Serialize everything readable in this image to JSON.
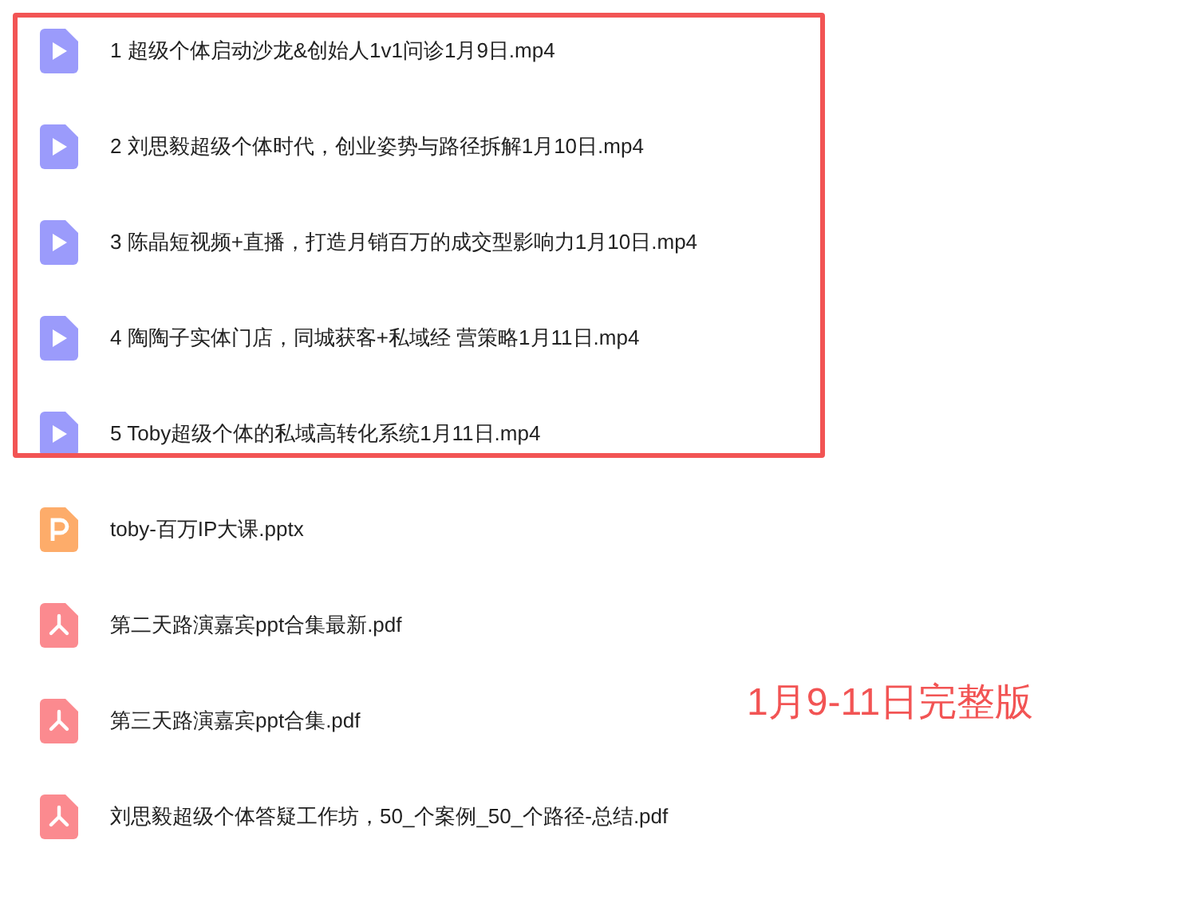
{
  "files": [
    {
      "kind": "video",
      "name": "1 超级个体启动沙龙&创始人1v1问诊1月9日.mp4"
    },
    {
      "kind": "video",
      "name": "2 刘思毅超级个体时代，创业姿势与路径拆解1月10日.mp4"
    },
    {
      "kind": "video",
      "name": "3 陈晶短视频+直播，打造月销百万的成交型影响力1月10日.mp4"
    },
    {
      "kind": "video",
      "name": "4 陶陶子实体门店，同城获客+私域经 营策略1月11日.mp4"
    },
    {
      "kind": "video",
      "name": "5 Toby超级个体的私域高转化系统1月11日.mp4"
    },
    {
      "kind": "pptx",
      "name": "toby-百万IP大课.pptx"
    },
    {
      "kind": "pdf",
      "name": "第二天路演嘉宾ppt合集最新.pdf"
    },
    {
      "kind": "pdf",
      "name": "第三天路演嘉宾ppt合集.pdf"
    },
    {
      "kind": "pdf",
      "name": "刘思毅超级个体答疑工作坊，50_个案例_50_个路径-总结.pdf"
    }
  ],
  "annotation": {
    "text": "1月9-11日完整版"
  }
}
